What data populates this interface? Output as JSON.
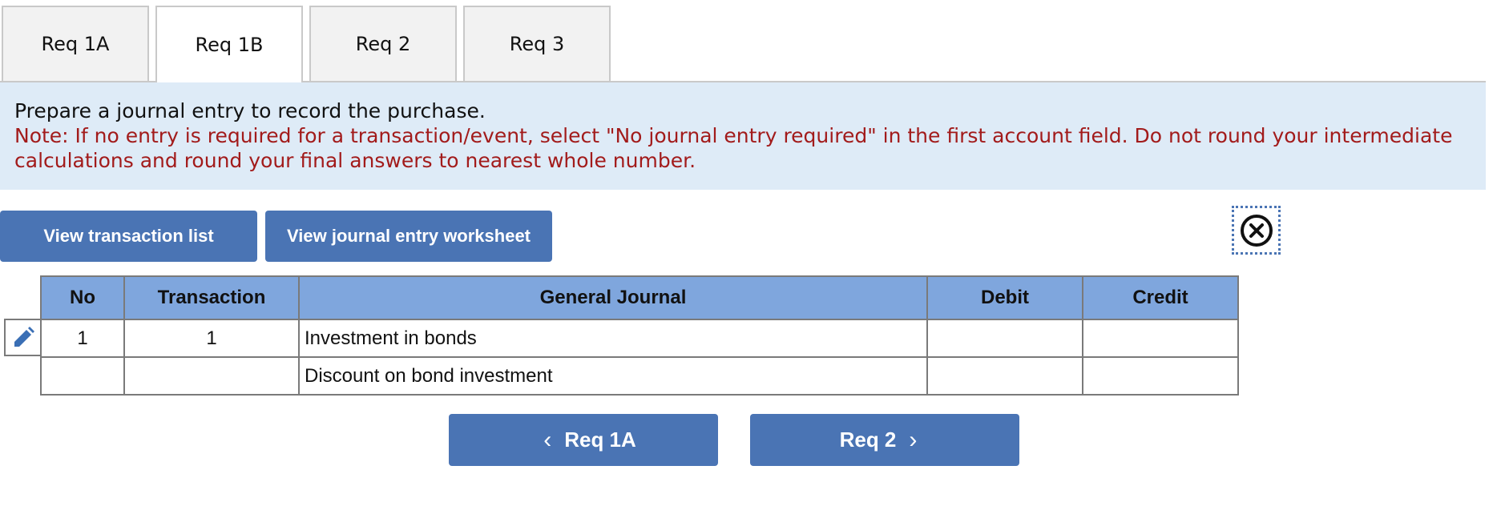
{
  "tabs": [
    {
      "label": "Req 1A",
      "active": false
    },
    {
      "label": "Req 1B",
      "active": true
    },
    {
      "label": "Req 2",
      "active": false
    },
    {
      "label": "Req 3",
      "active": false
    }
  ],
  "instructions": {
    "main": "Prepare a journal entry to record the purchase.",
    "note": "Note: If no entry is required for a transaction/event, select \"No journal entry required\" in the first account field. Do not round your intermediate calculations and round your final answers to nearest whole number."
  },
  "buttons": {
    "view_transaction_list": "View transaction list",
    "view_journal_worksheet": "View journal entry worksheet"
  },
  "close_icon": "close-circle-icon",
  "edit_icon": "pencil-icon",
  "table": {
    "headers": [
      "No",
      "Transaction",
      "General Journal",
      "Debit",
      "Credit"
    ],
    "rows": [
      {
        "no": "1",
        "transaction": "1",
        "account": "Investment in bonds",
        "debit": "",
        "credit": ""
      },
      {
        "no": "",
        "transaction": "",
        "account": "Discount on bond investment",
        "debit": "",
        "credit": ""
      }
    ]
  },
  "nav": {
    "prev_label": "Req 1A",
    "next_label": "Req 2"
  },
  "colors": {
    "accent": "#4a74b4",
    "header_bg": "#7fa6dd",
    "instruction_bg": "#deebf7",
    "note_text": "#a21b1b"
  }
}
